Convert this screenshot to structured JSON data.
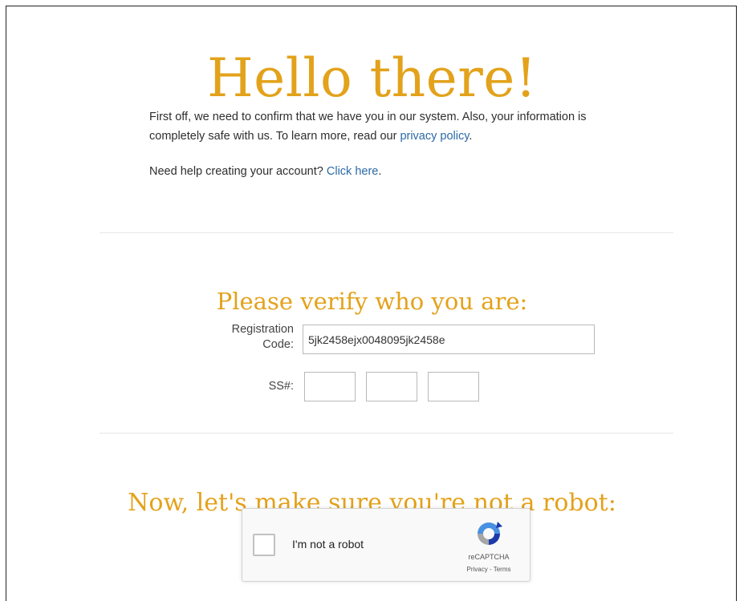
{
  "page": {
    "heading": "Hello there!",
    "intro_text": "First off, we need to confirm that we have you in our system. Also, your information is completely safe with us. To learn more, read our ",
    "privacy_link": "privacy policy",
    "intro_end": ".",
    "help_text": "Need help creating your account? ",
    "help_link": "Click here",
    "help_end": "."
  },
  "verify": {
    "title": "Please verify who you are:",
    "registration_label": "Registration Code:",
    "registration_value": "5jk2458ejx0048095jk2458e",
    "ss_label": "SS#:",
    "ss_part1": "",
    "ss_part2": "",
    "ss_part3": ""
  },
  "robot": {
    "title": "Now, let's make sure you're not a robot:",
    "checkbox_label": "I'm not a robot",
    "brand": "reCAPTCHA",
    "terms": "Privacy - Terms"
  },
  "colors": {
    "accent": "#e3a21b",
    "link": "#2b6aa6",
    "text": "#2e2e2e"
  }
}
